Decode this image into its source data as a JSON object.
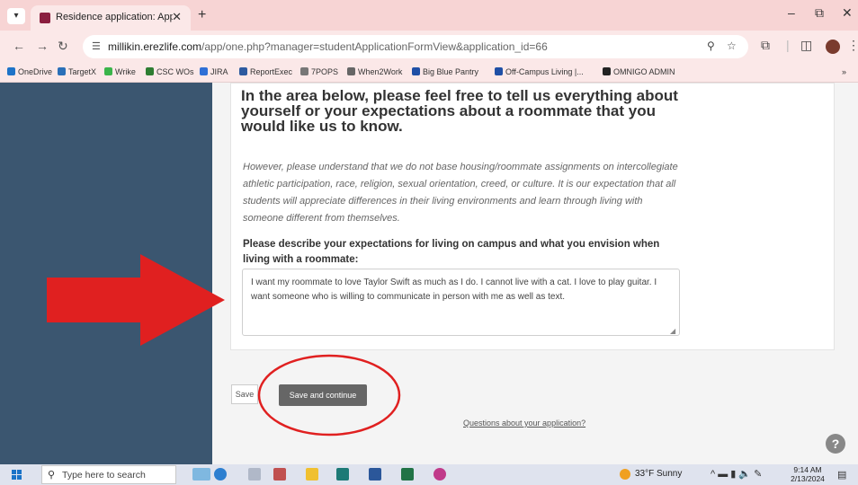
{
  "browser": {
    "tab_title": "Residence application: Applicat",
    "tab_close": "✕",
    "new_tab": "+",
    "url_host": "millikin.erezlife.com",
    "url_path": "/app/one.php?manager=studentApplicationFormView&application_id=66",
    "window_controls": {
      "minimize": "–",
      "restore": "⧉",
      "close": "✕"
    }
  },
  "bookmarks": [
    {
      "label": "OneDrive",
      "color": "#1e73c8"
    },
    {
      "label": "TargetX",
      "color": "#2a6fb8"
    },
    {
      "label": "Wrike",
      "color": "#3bb44a"
    },
    {
      "label": "CSC WOs",
      "color": "#2e7d32"
    },
    {
      "label": "JIRA",
      "color": "#2f6fd6"
    },
    {
      "label": "ReportExec",
      "color": "#2d5aa0"
    },
    {
      "label": "7POPS",
      "color": "#777777"
    },
    {
      "label": "When2Work",
      "color": "#666666"
    },
    {
      "label": "Big Blue Pantry",
      "color": "#1f4fa6"
    },
    {
      "label": "Off-Campus Living |...",
      "color": "#1f4fa6"
    },
    {
      "label": "OMNIGO ADMIN",
      "color": "#222222"
    }
  ],
  "bookmarks_overflow": "»",
  "form": {
    "heading": "In the area below, please feel free to tell us everything about yourself or your expectations about a roommate that you would like us to know.",
    "disclaimer": "However, please understand that we do not base housing/roommate assignments on intercollegiate athletic participation, race, religion, sexual orientation, creed, or culture. It is our expectation that all students will appreciate differences in their living environments and learn through living with someone different from themselves.",
    "question_label": "Please describe your expectations for living on campus and what you envision when living with a roommate:",
    "answer_value": "I want my roommate to love Taylor Swift as much as I do. I cannot live with a cat. I love to play guitar. I want someone who is willing to communicate in person with me as well as text.",
    "save_label": "Save",
    "save_continue_label": "Save and continue",
    "questions_link": "Questions about your application?",
    "help_label": "?"
  },
  "taskbar": {
    "search_placeholder": "Type here to search",
    "weather": "33°F  Sunny",
    "time": "9:14 AM",
    "date": "2/13/2024"
  },
  "colors": {
    "sidebar": "#3b5670",
    "annotation_red": "#e02020",
    "primary_button": "#666666"
  }
}
